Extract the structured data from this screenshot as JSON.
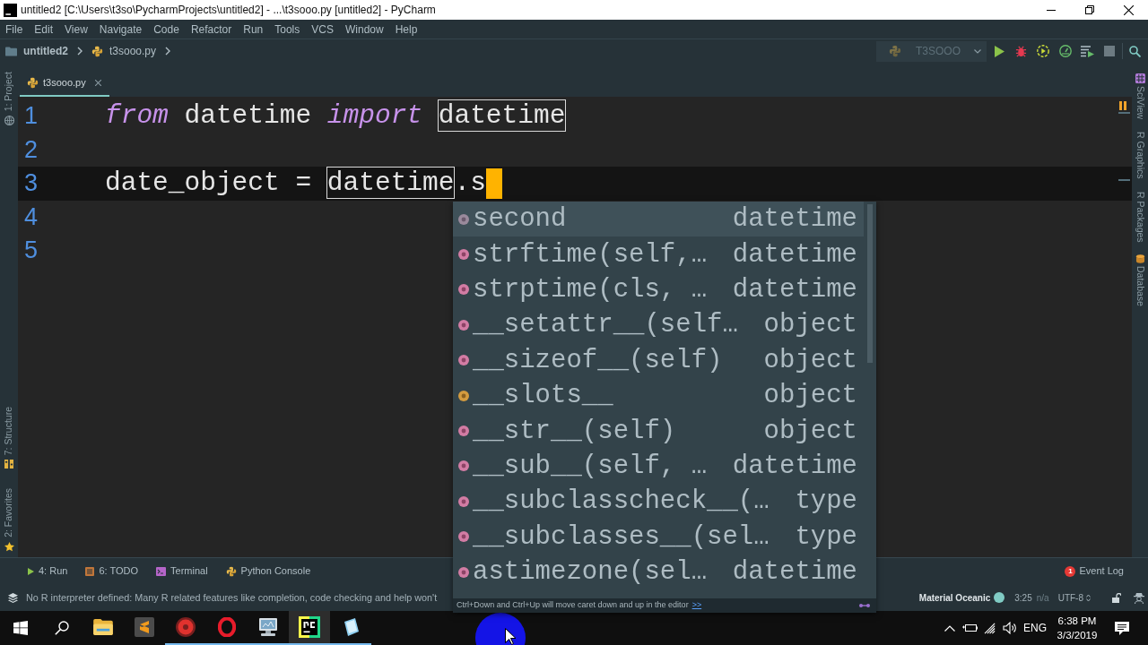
{
  "window": {
    "title": "untitled2 [C:\\Users\\t3so\\PycharmProjects\\untitled2] - ...\\t3sooo.py [untitled2] - PyCharm"
  },
  "menu": [
    "File",
    "Edit",
    "View",
    "Navigate",
    "Code",
    "Refactor",
    "Run",
    "Tools",
    "VCS",
    "Window",
    "Help"
  ],
  "breadcrumbs": [
    {
      "label": "untitled2",
      "kind": "project"
    },
    {
      "label": "t3sooo.py",
      "kind": "file"
    }
  ],
  "run_configuration": {
    "name": "T3SOOO"
  },
  "left_tool_strip": {
    "top": [
      {
        "label": "1: Project",
        "kind": "project"
      }
    ],
    "bottom": [
      {
        "label": "7: Structure",
        "kind": "structure"
      },
      {
        "label": "2: Favorites",
        "kind": "favorites"
      }
    ]
  },
  "right_tool_strip": [
    {
      "label": "SciView",
      "kind": "sciview"
    },
    {
      "label": "R Graphics",
      "kind": "plain"
    },
    {
      "label": "R Packages",
      "kind": "plain"
    },
    {
      "label": "Database",
      "kind": "database"
    }
  ],
  "tabs": [
    {
      "label": "t3sooo.py",
      "selected": true
    }
  ],
  "editor": {
    "lines": [
      {
        "number": "1",
        "current": false,
        "caret": false,
        "tokens": [
          {
            "text": "from",
            "kind": "keyword"
          },
          {
            "text": " datetime ",
            "kind": "plain"
          },
          {
            "text": "import ",
            "kind": "keyword"
          },
          {
            "text": "datetime",
            "kind": "match"
          }
        ]
      },
      {
        "number": "2",
        "current": false,
        "caret": false
      },
      {
        "number": "3",
        "current": true,
        "caret": true,
        "tokens": [
          {
            "text": "date_object = ",
            "kind": "plain"
          },
          {
            "text": "datetime",
            "kind": "match"
          },
          {
            "text": ".s",
            "kind": "plain"
          }
        ]
      },
      {
        "number": "4",
        "current": false,
        "caret": false
      },
      {
        "number": "5",
        "current": false,
        "caret": false
      }
    ]
  },
  "completion": {
    "items": [
      {
        "name": "second",
        "type": "datetime",
        "kind": "property",
        "selected": true
      },
      {
        "name": "strftime(self,…",
        "type": "datetime",
        "kind": "method",
        "selected": false
      },
      {
        "name": "strptime(cls, …",
        "type": "datetime",
        "kind": "method",
        "selected": false
      },
      {
        "name": "__setattr__(self…",
        "type": "object",
        "kind": "method",
        "selected": false
      },
      {
        "name": "__sizeof__(self)",
        "type": "object",
        "kind": "method",
        "selected": false
      },
      {
        "name": "__slots__",
        "type": "object",
        "kind": "field",
        "selected": false
      },
      {
        "name": "__str__(self)",
        "type": "object",
        "kind": "method",
        "selected": false
      },
      {
        "name": "__sub__(self, …",
        "type": "datetime",
        "kind": "method",
        "selected": false
      },
      {
        "name": "__subclasscheck__(…",
        "type": "type",
        "kind": "method",
        "selected": false
      },
      {
        "name": "__subclasses__(sel…",
        "type": "type",
        "kind": "method",
        "selected": false
      },
      {
        "name": "astimezone(sel…",
        "type": "datetime",
        "kind": "method",
        "selected": false
      }
    ],
    "hint": "Ctrl+Down and Ctrl+Up will move caret down and up in the editor",
    "hint_link": ">>"
  },
  "tool_windows": [
    {
      "label": "4: Run",
      "kind": "run"
    },
    {
      "label": "6: TODO",
      "kind": "todo"
    },
    {
      "label": "Terminal",
      "kind": "terminal"
    },
    {
      "label": "Python Console",
      "kind": "console"
    }
  ],
  "event_log": {
    "label": "Event Log",
    "count": "1"
  },
  "status_bar": {
    "message": "No R interpreter defined: Many R related features like completion, code checking and help won't",
    "theme": "Material Oceanic",
    "position": "3:25",
    "line_separator": "n/a",
    "encoding": "UTF-8"
  },
  "taskbar": {
    "apps": [
      {
        "kind": "folder",
        "running": false,
        "selected": false
      },
      {
        "kind": "sublime",
        "running": false,
        "selected": false
      },
      {
        "kind": "record",
        "running": true,
        "selected": false
      },
      {
        "kind": "opera",
        "running": true,
        "selected": false
      },
      {
        "kind": "monitor",
        "running": true,
        "selected": false
      },
      {
        "kind": "pycharm",
        "running": true,
        "selected": true
      },
      {
        "kind": "notepad",
        "running": true,
        "selected": false
      }
    ],
    "language": "ENG",
    "time": "6:38 PM",
    "date": "3/3/2019"
  }
}
